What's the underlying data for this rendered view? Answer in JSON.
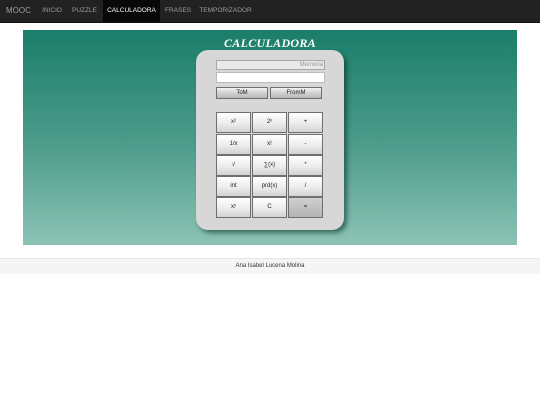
{
  "nav": {
    "brand": "MOOC",
    "items": [
      {
        "label": "INICIO"
      },
      {
        "label": "PUZZLE"
      },
      {
        "label": "CALCULADORA"
      },
      {
        "label": "FRASES"
      },
      {
        "label": "TEMPORIZADOR"
      }
    ]
  },
  "calculator": {
    "title": "CALCULADORA",
    "memory_placeholder": "Memoria",
    "display_value": "",
    "memory_buttons": [
      "ToM",
      "FromM"
    ],
    "rows": [
      [
        "x²",
        "2ˣ",
        "+"
      ],
      [
        "1/x",
        "x!",
        "-"
      ],
      [
        "√",
        "∑(x)",
        "*"
      ],
      [
        "int",
        "prd(x)",
        "/"
      ],
      [
        "xʸ",
        "C",
        "="
      ]
    ]
  },
  "footer": {
    "author": "Ana Isabel Lucena Molina"
  }
}
